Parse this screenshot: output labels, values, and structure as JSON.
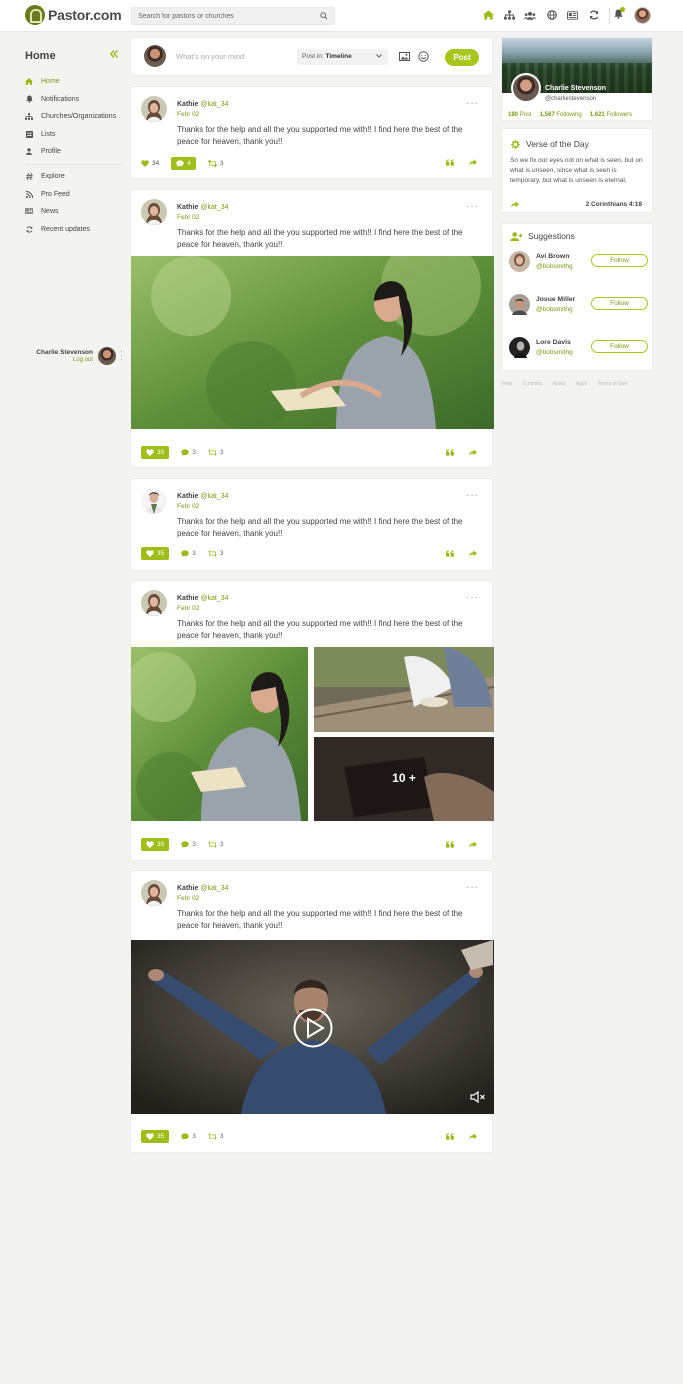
{
  "brand": {
    "name": "Pastor.com",
    "accent": "#a8c71d",
    "accent_dark": "#7a9a12"
  },
  "search": {
    "placeholder": "Search for pastors or churches"
  },
  "topnav": {
    "icons": [
      "home-icon",
      "org-chart-icon",
      "users-icon",
      "globe-icon",
      "news-icon",
      "refresh-icon"
    ]
  },
  "sidebar": {
    "title": "Home",
    "items": [
      {
        "label": "Home",
        "icon": "home-icon"
      },
      {
        "label": "Notifications",
        "icon": "bell-icon"
      },
      {
        "label": "Churches/Organizations",
        "icon": "org-chart-icon"
      },
      {
        "label": "Lists",
        "icon": "list-icon"
      },
      {
        "label": "Profile",
        "icon": "user-icon"
      },
      {
        "label": "Explore",
        "icon": "hashtag-icon"
      },
      {
        "label": "Pro Feed",
        "icon": "rss-icon"
      },
      {
        "label": "News",
        "icon": "news-icon"
      },
      {
        "label": "Recent updates",
        "icon": "refresh-icon"
      }
    ],
    "user": {
      "name": "Charlie Stevenson",
      "logout": "Log out"
    }
  },
  "composer": {
    "placeholder": "What's on your mind",
    "post_in_label": "Post in:",
    "post_in_value": "Timeline",
    "post_button": "Post"
  },
  "posts": [
    {
      "author": "Kathie",
      "handle": "@kat_34",
      "date": "Febr 02",
      "text": "Thanks for the help and all the you supported me with!! I find here the best of the peace for heaven, thank you!!",
      "likes": "34",
      "comments": "4",
      "reposts": "3"
    },
    {
      "author": "Kathie",
      "handle": "@kat_34",
      "date": "Febr 02",
      "text": "Thanks for the help and all the you supported me with!! I find here the best of the peace for heaven, thank you!!",
      "likes": "35",
      "comments": "3",
      "reposts": "3"
    },
    {
      "author": "Kathie",
      "handle": "@kat_34",
      "date": "Febr 02",
      "text": "Thanks for the help and all the you supported me with!! I find here the best of the peace for heaven, thank you!!",
      "likes": "35",
      "comments": "3",
      "reposts": "3"
    },
    {
      "author": "Kathie",
      "handle": "@kat_34",
      "date": "Febr 02",
      "text": "Thanks for the help and all the you supported me with!! I find here the best of the peace for heaven, thank you!!",
      "likes": "35",
      "comments": "3",
      "reposts": "3",
      "more_images": "10 +"
    },
    {
      "author": "Kathie",
      "handle": "@kat_34",
      "date": "Febr 02",
      "text": "Thanks for the help and all the you supported me with!! I find here the best of the peace for heaven, thank you!!",
      "likes": "35",
      "comments": "3",
      "reposts": "3"
    }
  ],
  "profile": {
    "name": "Charlie Stevenson",
    "handle": "@charliestevenson",
    "posts_count": "180",
    "posts_label": "Post",
    "following_count": "1,587",
    "following_label": "Following",
    "followers_count": "1,621",
    "followers_label": "Followers"
  },
  "verse": {
    "title": "Verse of the Day",
    "text": "So we fix our eyes not on what is seen, but on what is unseen, since what is seen is temporary, but what is unseen is eternal.",
    "reference": "2 Corinthians 4:18"
  },
  "suggestions": {
    "title": "Suggestions",
    "follow_label": "Follow",
    "people": [
      {
        "name": "Avi Brown",
        "handle": "@bobsmithg"
      },
      {
        "name": "Josue Miller",
        "handle": "@bobsmithg"
      },
      {
        "name": "Lore Davis",
        "handle": "@bobsmithg"
      }
    ]
  },
  "footer": {
    "links": [
      "Help",
      "Commits",
      "About",
      "Apps",
      "Terms of Sale"
    ]
  }
}
